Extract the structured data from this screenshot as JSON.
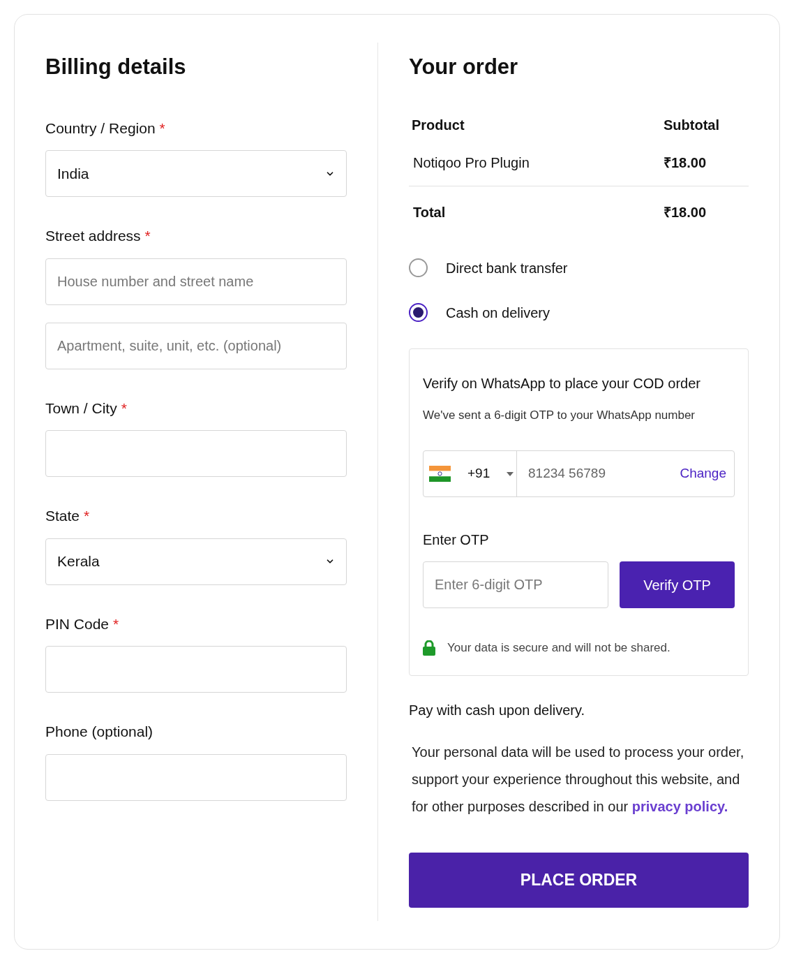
{
  "billing": {
    "title": "Billing details",
    "fields": [
      {
        "label": "Country / Region",
        "required_mark": "*",
        "controls": [
          {
            "kind": "select",
            "value": "India"
          }
        ]
      },
      {
        "label": "Street address",
        "required_mark": "*",
        "controls": [
          {
            "kind": "input",
            "placeholder": "House number and street name"
          },
          {
            "kind": "input",
            "placeholder": "Apartment, suite, unit, etc. (optional)"
          }
        ]
      },
      {
        "label": "Town / City",
        "required_mark": "*",
        "controls": [
          {
            "kind": "input"
          }
        ]
      },
      {
        "label": "State",
        "required_mark": "*",
        "controls": [
          {
            "kind": "select",
            "value": "Kerala"
          }
        ]
      },
      {
        "label": "PIN Code",
        "required_mark": "*",
        "controls": [
          {
            "kind": "input"
          }
        ]
      },
      {
        "label": "Phone (optional)",
        "controls": [
          {
            "kind": "input"
          }
        ]
      }
    ]
  },
  "order": {
    "title": "Your order",
    "columns": [
      "Product",
      "Subtotal"
    ],
    "rows": [
      [
        "Notiqoo Pro Plugin",
        "₹18.00"
      ]
    ],
    "total": [
      "Total",
      "₹18.00"
    ],
    "payment_methods": [
      {
        "label": "Direct bank transfer",
        "selected": false
      },
      {
        "label": "Cash on delivery",
        "selected": true
      }
    ],
    "verify": {
      "title": "Verify on WhatsApp to place your COD order",
      "subtitle": "We've sent a 6-digit OTP to your WhatsApp number",
      "dial_code": "+91",
      "phone": "81234 56789",
      "change": "Change",
      "otp_label": "Enter OTP",
      "otp_placeholder": "Enter 6-digit OTP",
      "verify_button": "Verify OTP",
      "secure_note": "Your data is secure and will not be shared."
    },
    "payment_note": "Pay with cash upon delivery.",
    "privacy_text": "Your personal data will be used to process your order, support your experience throughout this website, and for other purposes described in our ",
    "privacy_link": "privacy policy.",
    "place_order": "PLACE ORDER"
  }
}
